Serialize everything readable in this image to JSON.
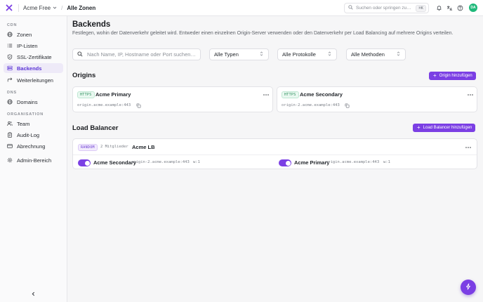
{
  "topbar": {
    "workspace": "Acme Free",
    "breadcrumb_current": "Alle Zonen",
    "search_placeholder": "Suchen oder springen zu…",
    "search_shortcut": "⌘K",
    "avatar_initials": "DA"
  },
  "sidebar": {
    "sections": [
      {
        "label": "CDN",
        "items": [
          {
            "label": "Zonen",
            "icon": "globe-icon",
            "active": false
          },
          {
            "label": "IP-Listen",
            "icon": "list-icon",
            "active": false
          },
          {
            "label": "SSL-Zertifikate",
            "icon": "shield-icon",
            "active": false
          },
          {
            "label": "Backends",
            "icon": "server-icon",
            "active": true
          },
          {
            "label": "Weiterleitungen",
            "icon": "redirect-icon",
            "active": false
          }
        ]
      },
      {
        "label": "DNS",
        "items": [
          {
            "label": "Domains",
            "icon": "globe-icon",
            "active": false
          }
        ]
      },
      {
        "label": "ORGANISATION",
        "items": [
          {
            "label": "Team",
            "icon": "users-icon",
            "active": false
          },
          {
            "label": "Audit-Log",
            "icon": "clipboard-icon",
            "active": false
          },
          {
            "label": "Abrechnung",
            "icon": "credit-card-icon",
            "active": false
          },
          {
            "label": "Admin-Bereich",
            "icon": "settings-icon",
            "active": false
          }
        ]
      }
    ]
  },
  "page": {
    "title": "Backends",
    "description": "Festlegen, wohin der Datenverkehr geleitet wird. Entweder einen einzelnen Origin-Server verwenden oder den Datenverkehr per Load Balancing auf mehrere Origins verteilen."
  },
  "filters": {
    "search_placeholder": "Nach Name, IP, Hostname oder Port suchen…",
    "type": "Alle Typen",
    "protocol": "Alle Protokolle",
    "method": "Alle Methoden"
  },
  "origins": {
    "title": "Origins",
    "add_label": "Origin hinzufügen",
    "items": [
      {
        "protocol": "HTTPS",
        "name": "Acme Primary",
        "address": "origin.acme.example:443"
      },
      {
        "protocol": "HTTPS",
        "name": "Acme Secondary",
        "address": "origin-2.acme.example:443"
      }
    ]
  },
  "load_balancer": {
    "title": "Load Balancer",
    "add_label": "Load Balancer hinzufügen",
    "items": [
      {
        "method": "RANDOM",
        "members_count": "2 Mitglieder",
        "name": "Acme LB",
        "members": [
          {
            "name": "Acme Secondary",
            "address": "origin-2.acme.example:443",
            "weight": "w:1",
            "enabled": true
          },
          {
            "name": "Acme Primary",
            "address": "origin.acme.example:443",
            "weight": "w:1",
            "enabled": true
          }
        ]
      }
    ]
  },
  "colors": {
    "accent": "#7b3fe4",
    "active_nav_bg": "#eeeaf8",
    "https_green": "#2c8f5c"
  }
}
